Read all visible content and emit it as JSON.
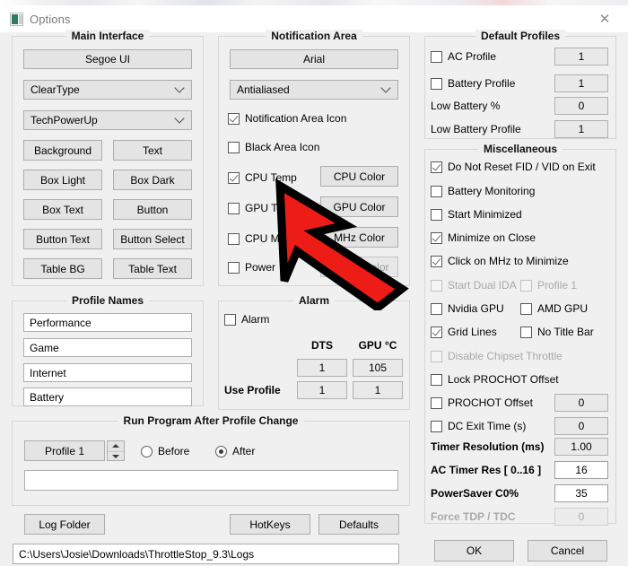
{
  "window": {
    "title": "Options",
    "icon": "app-icon",
    "close_label": "✕"
  },
  "main_interface": {
    "title": "Main Interface",
    "font_button": "Segoe UI",
    "render_combo": "ClearType",
    "theme_combo": "TechPowerUp",
    "color_buttons": [
      "Background",
      "Text",
      "Box Light",
      "Box Dark",
      "Box Text",
      "Button",
      "Button Text",
      "Button Select",
      "Table BG",
      "Table Text"
    ]
  },
  "notification_area": {
    "title": "Notification Area",
    "font_button": "Arial",
    "render_combo": "Antialiased",
    "checkboxes": [
      {
        "label": "Notification Area Icon",
        "checked": true
      },
      {
        "label": "Black Area Icon",
        "checked": false
      },
      {
        "label": "CPU Temp",
        "checked": true
      },
      {
        "label": "GPU Temp",
        "checked": false
      },
      {
        "label": "CPU MHz",
        "checked": false
      },
      {
        "label": "Power",
        "checked": false
      }
    ],
    "color_buttons": [
      "CPU Color",
      "GPU Color",
      "MHz Color",
      "Power Color"
    ]
  },
  "default_profiles": {
    "title": "Default Profiles",
    "rows": [
      {
        "label": "AC Profile",
        "type": "checkbox",
        "checked": false,
        "value": "1"
      },
      {
        "label": "Battery Profile",
        "type": "checkbox",
        "checked": false,
        "value": "1"
      },
      {
        "label": "Low Battery %",
        "type": "label",
        "value": "0"
      },
      {
        "label": "Low Battery Profile",
        "type": "label",
        "value": "1"
      }
    ]
  },
  "miscellaneous": {
    "title": "Miscellaneous",
    "checkboxes": [
      {
        "label": "Do Not Reset FID / VID on Exit",
        "checked": true,
        "disabled": false
      },
      {
        "label": "Battery Monitoring",
        "checked": false,
        "disabled": false
      },
      {
        "label": "Start Minimized",
        "checked": false,
        "disabled": false
      },
      {
        "label": "Minimize on Close",
        "checked": true,
        "disabled": false
      },
      {
        "label": "Click on MHz to Minimize",
        "checked": true,
        "disabled": false
      },
      {
        "label": "Start Dual IDA",
        "checked": false,
        "disabled": true
      },
      {
        "label": "Profile 1",
        "checked": false,
        "disabled": true
      },
      {
        "label": "Nvidia GPU",
        "checked": false,
        "disabled": false
      },
      {
        "label": "AMD GPU",
        "checked": false,
        "disabled": false
      },
      {
        "label": "Grid Lines",
        "checked": true,
        "disabled": false
      },
      {
        "label": "No Title Bar",
        "checked": false,
        "disabled": false
      },
      {
        "label": "Disable Chipset Throttle",
        "checked": false,
        "disabled": true
      },
      {
        "label": "Lock PROCHOT Offset",
        "checked": false,
        "disabled": false
      },
      {
        "label": "PROCHOT Offset",
        "checked": false,
        "disabled": false
      },
      {
        "label": "DC Exit Time (s)",
        "checked": false,
        "disabled": false
      }
    ],
    "value_rows": [
      {
        "label": "PROCHOT Offset",
        "value": "0",
        "editable": false,
        "disabled": false
      },
      {
        "label": "DC Exit Time (s)",
        "value": "0",
        "editable": false,
        "disabled": false
      },
      {
        "label": "Timer Resolution (ms)",
        "value": "1.00",
        "editable": false,
        "disabled": false
      },
      {
        "label": "AC Timer Res [ 0..16 ]",
        "value": "16",
        "editable": true,
        "disabled": false
      },
      {
        "label": "PowerSaver C0%",
        "value": "35",
        "editable": true,
        "disabled": false
      },
      {
        "label": "Force TDP / TDC",
        "value": "0",
        "editable": false,
        "disabled": true
      }
    ]
  },
  "profile_names": {
    "title": "Profile Names",
    "values": [
      "Performance",
      "Game",
      "Internet",
      "Battery"
    ]
  },
  "alarm": {
    "title": "Alarm",
    "checkbox": {
      "label": "Alarm",
      "checked": false
    },
    "col_headers": [
      "DTS",
      "GPU °C"
    ],
    "threshold_values": [
      "1",
      "105"
    ],
    "use_profile_label": "Use Profile",
    "use_profile_values": [
      "1",
      "1"
    ]
  },
  "run_program": {
    "title": "Run Program After Profile Change",
    "profile_button": "Profile 1",
    "radios": [
      {
        "label": "Before",
        "selected": false
      },
      {
        "label": "After",
        "selected": true
      }
    ],
    "path_value": "",
    "path_placeholder": ""
  },
  "footer": {
    "log_folder_button": "Log Folder",
    "hotkeys_button": "HotKeys",
    "defaults_button": "Defaults",
    "log_path": "C:\\Users\\Josie\\Downloads\\ThrottleStop_9.3\\Logs",
    "ok_button": "OK",
    "cancel_button": "Cancel"
  },
  "cursor": {
    "type": "arrow-pointer",
    "color": "#ED1C16",
    "outline": "#000000"
  }
}
